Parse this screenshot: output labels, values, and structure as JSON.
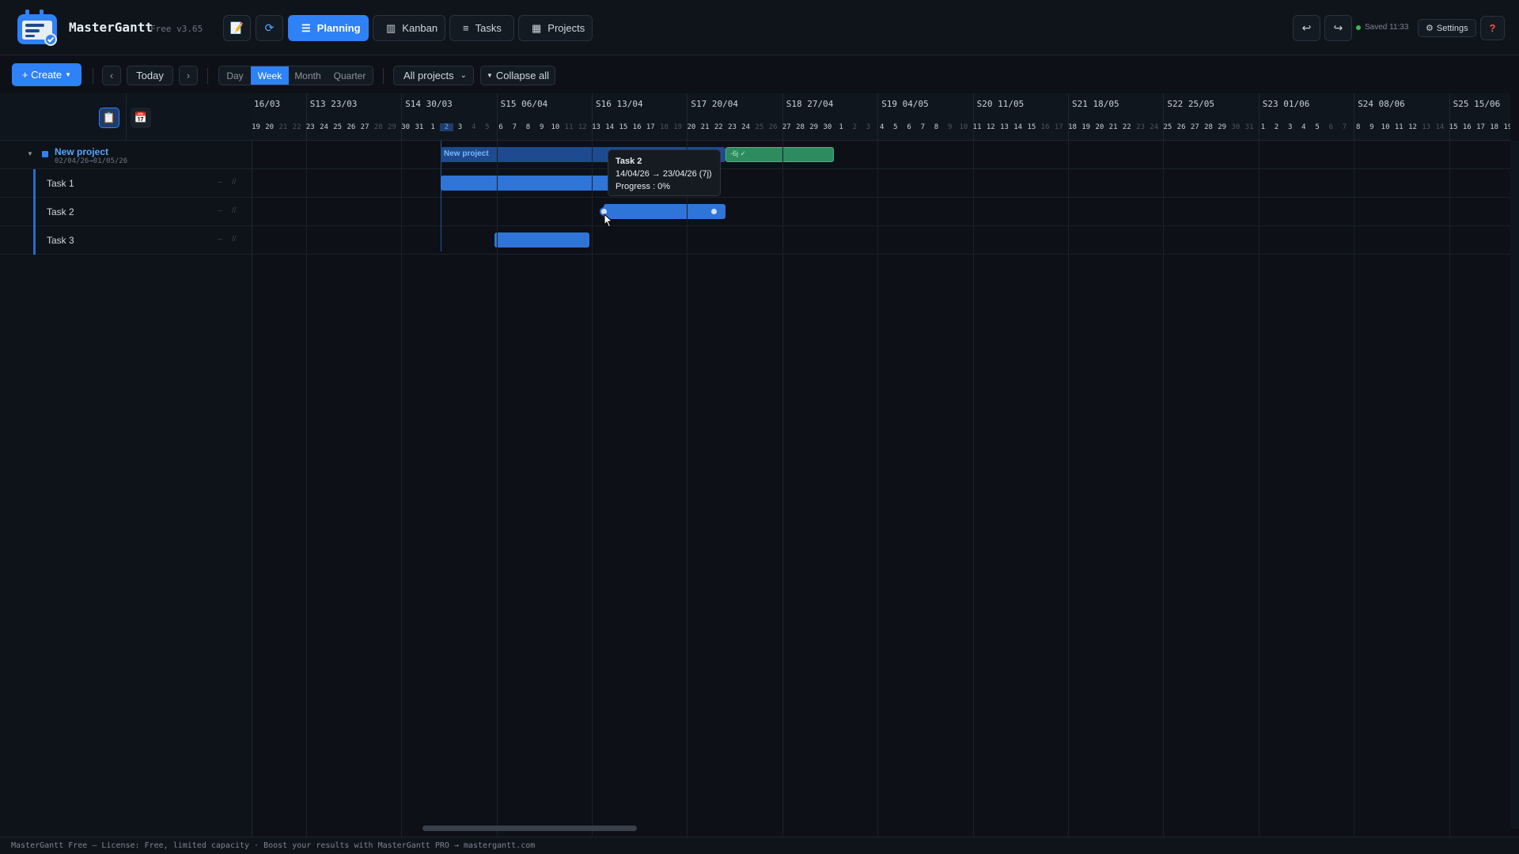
{
  "app": {
    "name": "MasterGantt",
    "version": "Free v3.65"
  },
  "nav": {
    "notes_icon": "memo-icon",
    "sync_icon": "sync-icon",
    "items": [
      {
        "label": "Planning",
        "icon": "timeline-icon",
        "active": true
      },
      {
        "label": "Kanban",
        "icon": "kanban-icon",
        "active": false
      },
      {
        "label": "Tasks",
        "icon": "list-icon",
        "active": false
      },
      {
        "label": "Projects",
        "icon": "grid-icon",
        "active": false
      }
    ]
  },
  "header_right": {
    "saved": "Saved 11:33",
    "settings": "Settings",
    "help": "?"
  },
  "toolbar": {
    "create": "+ Create",
    "prev": "‹",
    "today": "Today",
    "next": "›",
    "scales": [
      "Day",
      "Week",
      "Month",
      "Quarter"
    ],
    "active_scale": "Week",
    "project_filter": "All projects",
    "collapse": "Collapse all"
  },
  "gantt": {
    "weeks": [
      "16/03",
      "S13 23/03",
      "S14 30/03",
      "S15 06/04",
      "S16 13/04",
      "S17 20/04",
      "S18 27/04",
      "S19 04/05",
      "S20 11/05",
      "S21 18/05",
      "S22 25/05",
      "S23 01/06",
      "S24 08/06",
      "S25 15/06"
    ],
    "days": [
      "19",
      "20",
      "21",
      "22",
      "23",
      "24",
      "25",
      "26",
      "27",
      "28",
      "29",
      "30",
      "31",
      "1",
      "2",
      "3",
      "4",
      "5",
      "6",
      "7",
      "8",
      "9",
      "10",
      "11",
      "12",
      "13",
      "14",
      "15",
      "16",
      "17",
      "18",
      "19",
      "20",
      "21",
      "22",
      "23",
      "24",
      "25",
      "26",
      "27",
      "28",
      "29",
      "30",
      "1",
      "2",
      "3",
      "4",
      "5",
      "6",
      "7",
      "8",
      "9",
      "10",
      "11",
      "12",
      "13",
      "14",
      "15",
      "16",
      "17",
      "18",
      "19",
      "20",
      "21",
      "22",
      "23",
      "24",
      "25",
      "26",
      "27",
      "28",
      "29",
      "30",
      "31",
      "1",
      "2",
      "3",
      "4",
      "5",
      "6",
      "7",
      "8",
      "9",
      "10",
      "11",
      "12",
      "13",
      "14",
      "15",
      "16",
      "17",
      "18",
      "19",
      "2"
    ],
    "project": {
      "name": "New project",
      "dates": "02/04/26→01/05/26",
      "bar_label": "New project",
      "overflow_label": "-6j ✓"
    },
    "tasks": [
      {
        "name": "Task 1"
      },
      {
        "name": "Task 2"
      },
      {
        "name": "Task 3"
      }
    ],
    "row_controls": [
      "–",
      "//"
    ]
  },
  "tooltip": {
    "title": "Task 2",
    "dates": "14/04/26 → 23/04/26 (7j)",
    "progress": "Progress : 0%"
  },
  "footer": "MasterGantt Free — License: Free, limited capacity · Boost your results with MasterGantt PRO → mastergantt.com"
}
